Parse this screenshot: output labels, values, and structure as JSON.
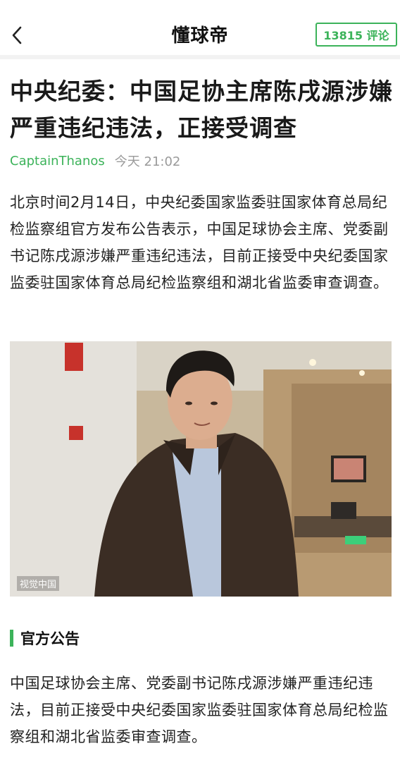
{
  "header": {
    "brand": "懂球帝",
    "comment_button": "13815 评论"
  },
  "article": {
    "title": "中央纪委：中国足协主席陈戌源涉嫌严重违纪违法，正接受调查",
    "author": "CaptainThanos",
    "time": "今天 21:02",
    "paragraph_1": "北京时间2月14日，中央纪委国家监委驻国家体育总局纪检监察组官方发布公告表示，中国足球协会主席、党委副书记陈戌源涉嫌严重违纪违法，目前正接受中央纪委国家监委驻国家体育总局纪检监察组和湖北省监委审查调查。",
    "photo_watermark": "视觉中国",
    "section_title": "官方公告",
    "paragraph_2": "中国足球协会主席、党委副书记陈戌源涉嫌严重违纪违法，目前正接受中央纪委国家监委驻国家体育总局纪检监察组和湖北省监委审查调查。"
  },
  "colors": {
    "accent": "#3cb35a",
    "meta_gray": "#9a9a9a"
  },
  "icons": {
    "back": "chevron-left-icon"
  }
}
